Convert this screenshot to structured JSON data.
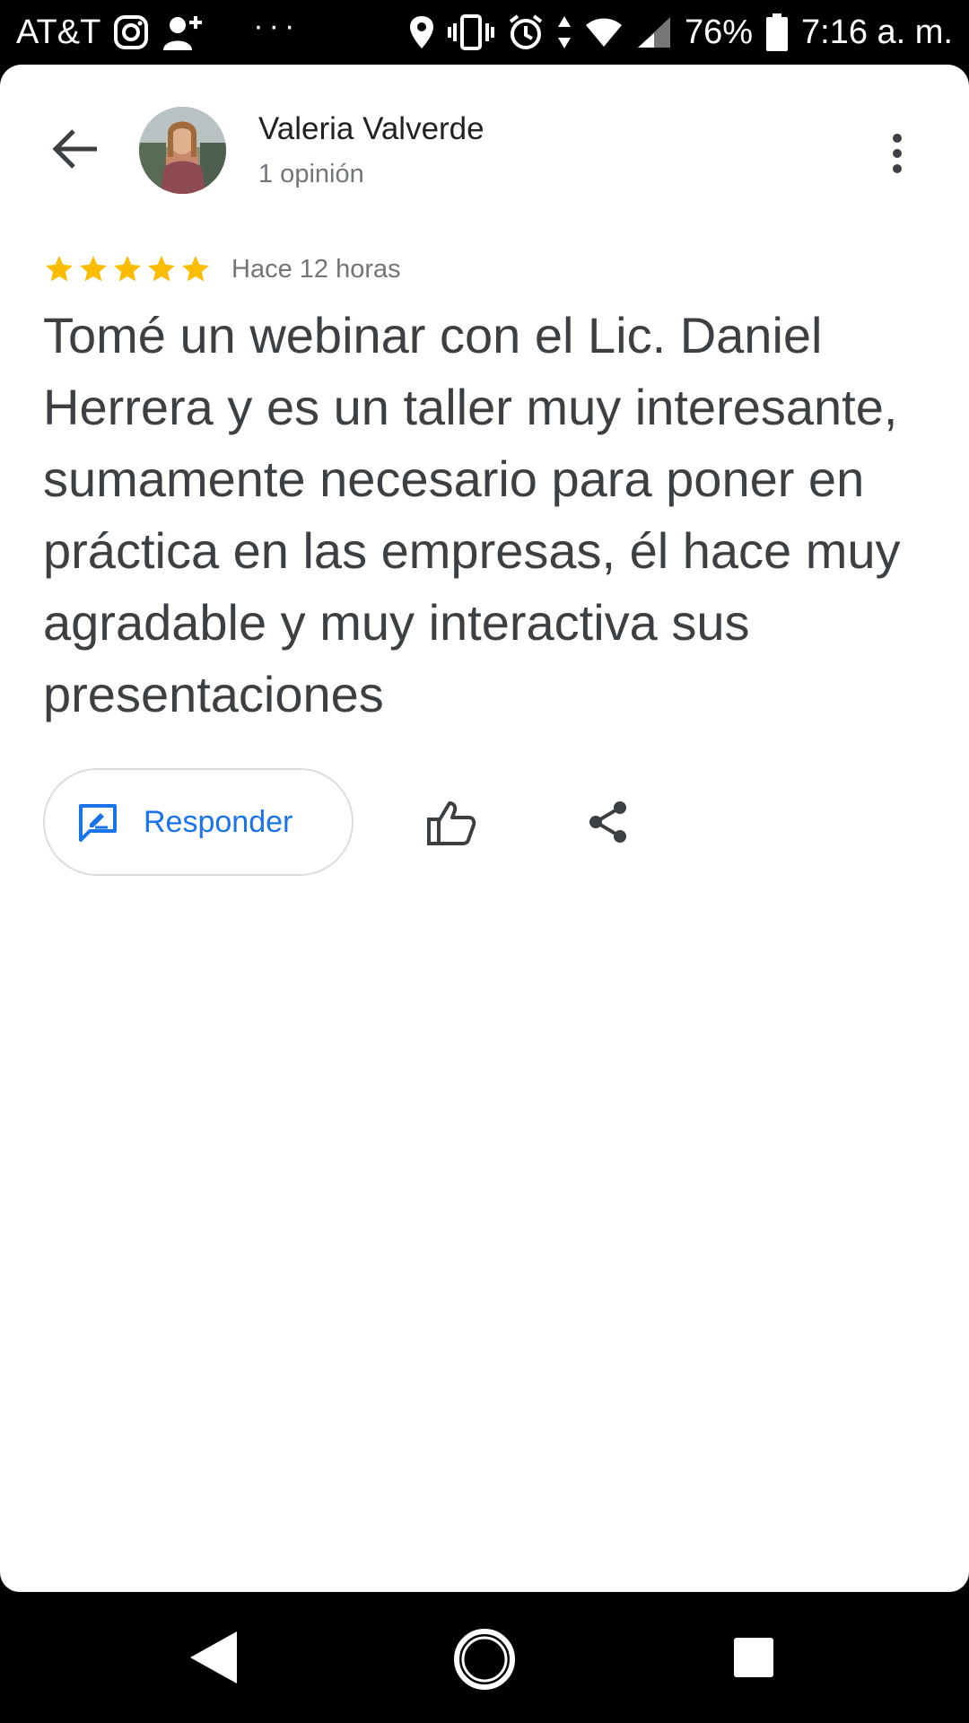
{
  "status_bar": {
    "carrier": "AT&T",
    "dots": "···",
    "battery": "76%",
    "time": "7:16 a. m."
  },
  "header": {
    "user_name": "Valeria Valverde",
    "user_reviews": "1 opinión"
  },
  "review": {
    "rating": 5,
    "time": "Hace 12 horas",
    "text": "Tomé un webinar con el Lic. Daniel Herrera y es un taller muy interesante, sumamente necesario para poner en práctica en las empresas, él hace muy agradable y muy interactiva sus presentaciones"
  },
  "actions": {
    "reply_label": "Responder"
  },
  "colors": {
    "star": "#fbbc04",
    "accent": "#1a73e8"
  }
}
